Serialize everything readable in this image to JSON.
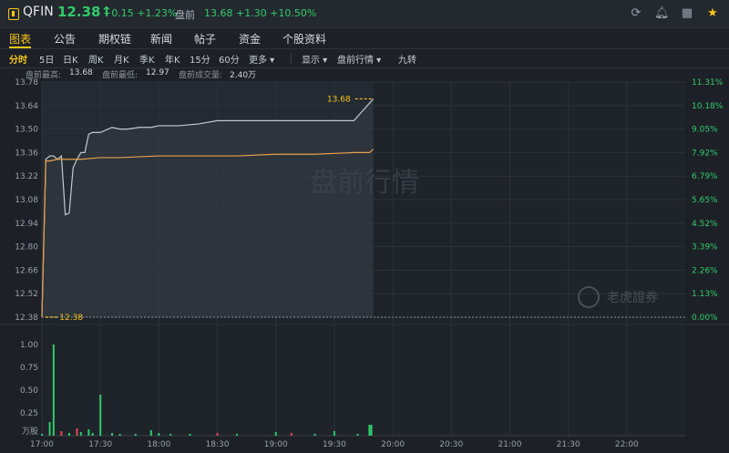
{
  "header": {
    "symbol": "QFIN",
    "price": "12.38↑",
    "change": "+0.15  +1.23%",
    "premarket_label": "盘前",
    "premarket_values": "13.68  +1.30  +10.50%",
    "icons": [
      "refresh-icon",
      "bell-icon",
      "grid-icon",
      "star-icon"
    ]
  },
  "tabs": [
    {
      "label": "图表",
      "active": true
    },
    {
      "label": "公告"
    },
    {
      "label": "期权链"
    },
    {
      "label": "新闻"
    },
    {
      "label": "帖子"
    },
    {
      "label": "资金"
    },
    {
      "label": "个股资料"
    }
  ],
  "periods": [
    {
      "label": "分时",
      "active": true
    },
    {
      "label": "5日"
    },
    {
      "label": "日K"
    },
    {
      "label": "周K"
    },
    {
      "label": "月K"
    },
    {
      "label": "季K"
    },
    {
      "label": "年K"
    },
    {
      "label": "15分"
    },
    {
      "label": "60分"
    },
    {
      "label": "更多 ▾"
    }
  ],
  "toolbar": {
    "display": "显示 ▾",
    "premarket_quote": "盘前行情 ▾",
    "nine_turn": "九转"
  },
  "stats": {
    "high_label": "盘前最高:",
    "high": "13.68",
    "low_label": "盘前最低:",
    "low": "12.97",
    "volume_label": "盘前成交量:",
    "volume": "2.40万"
  },
  "chart_data": {
    "type": "line",
    "watermark": "盘前行情",
    "brand_watermark": "老虎證券",
    "y_left_ticks": [
      "13.78",
      "13.64",
      "13.50",
      "13.36",
      "13.22",
      "13.08",
      "12.94",
      "12.80",
      "12.66",
      "12.52",
      "12.38"
    ],
    "y_right_ticks": [
      "11.31%",
      "10.18%",
      "9.05%",
      "7.92%",
      "6.79%",
      "5.65%",
      "4.52%",
      "3.39%",
      "2.26%",
      "1.13%",
      "0.00%"
    ],
    "ylim": [
      12.38,
      13.78
    ],
    "reference_price": 12.38,
    "reference_label": "12.38",
    "last_label": "13.68",
    "x_labels": [
      "17:00",
      "17:30",
      "18:00",
      "18:30",
      "19:00",
      "19:30",
      "20:00",
      "20:30",
      "21:00",
      "21:30",
      "22:00"
    ],
    "series": [
      {
        "color": "#c5c9cf",
        "x": [
          0,
          2,
          4,
          6,
          8,
          10,
          12,
          14,
          16,
          18,
          20,
          22,
          24,
          26,
          30,
          36,
          40,
          44,
          50,
          56,
          60,
          70,
          80,
          90,
          100,
          110,
          120,
          130,
          140,
          150,
          160,
          170
        ],
        "values": [
          12.38,
          13.32,
          13.34,
          13.34,
          13.32,
          13.34,
          12.99,
          13.0,
          13.27,
          13.32,
          13.36,
          13.36,
          13.47,
          13.48,
          13.48,
          13.51,
          13.5,
          13.5,
          13.51,
          13.51,
          13.52,
          13.52,
          13.53,
          13.55,
          13.55,
          13.55,
          13.55,
          13.55,
          13.55,
          13.55,
          13.55,
          13.68
        ]
      },
      {
        "color": "#e8a04a",
        "x": [
          0,
          2,
          4,
          8,
          14,
          20,
          30,
          40,
          60,
          80,
          100,
          120,
          140,
          160,
          168,
          170
        ],
        "values": [
          12.38,
          13.31,
          13.31,
          13.32,
          13.32,
          13.32,
          13.33,
          13.33,
          13.34,
          13.34,
          13.34,
          13.35,
          13.35,
          13.36,
          13.36,
          13.38
        ]
      }
    ],
    "volume": {
      "ylabel": "万股",
      "ticks": [
        "1.00",
        "0.75",
        "0.50",
        "0.25"
      ],
      "ylim": [
        0,
        1.0
      ],
      "x": [
        0,
        4,
        6,
        10,
        14,
        18,
        20,
        24,
        26,
        30,
        36,
        40,
        48,
        56,
        60,
        66,
        76,
        90,
        100,
        120,
        128,
        140,
        150,
        162,
        168,
        169
      ],
      "values": [
        0.02,
        0.15,
        1.0,
        0.05,
        0.03,
        0.08,
        0.04,
        0.07,
        0.03,
        0.45,
        0.03,
        0.02,
        0.02,
        0.06,
        0.03,
        0.02,
        0.02,
        0.03,
        0.02,
        0.04,
        0.03,
        0.02,
        0.05,
        0.02,
        0.12,
        0.12
      ],
      "colors": [
        "green",
        "green",
        "green",
        "red",
        "green",
        "red",
        "green",
        "green",
        "green",
        "green",
        "green",
        "green",
        "green",
        "green",
        "green",
        "green",
        "green",
        "red",
        "green",
        "green",
        "red",
        "green",
        "green",
        "green",
        "green",
        "green"
      ]
    }
  }
}
